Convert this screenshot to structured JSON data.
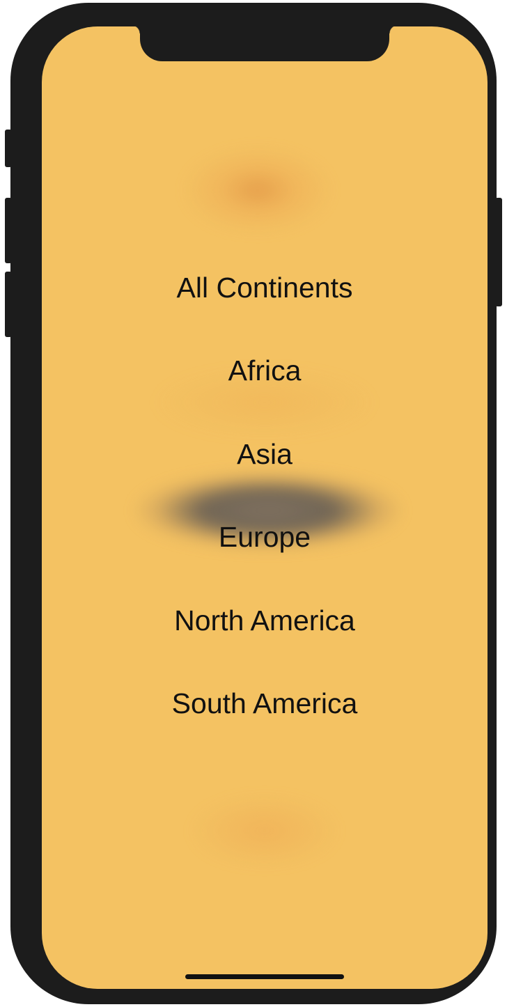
{
  "menu": {
    "items": [
      {
        "label": "All Continents"
      },
      {
        "label": "Africa"
      },
      {
        "label": "Asia"
      },
      {
        "label": "Europe"
      },
      {
        "label": "North America"
      },
      {
        "label": "South America"
      }
    ]
  },
  "colors": {
    "screen_background": "#f4c262",
    "device_frame": "#1c1c1c",
    "text": "#111111"
  }
}
